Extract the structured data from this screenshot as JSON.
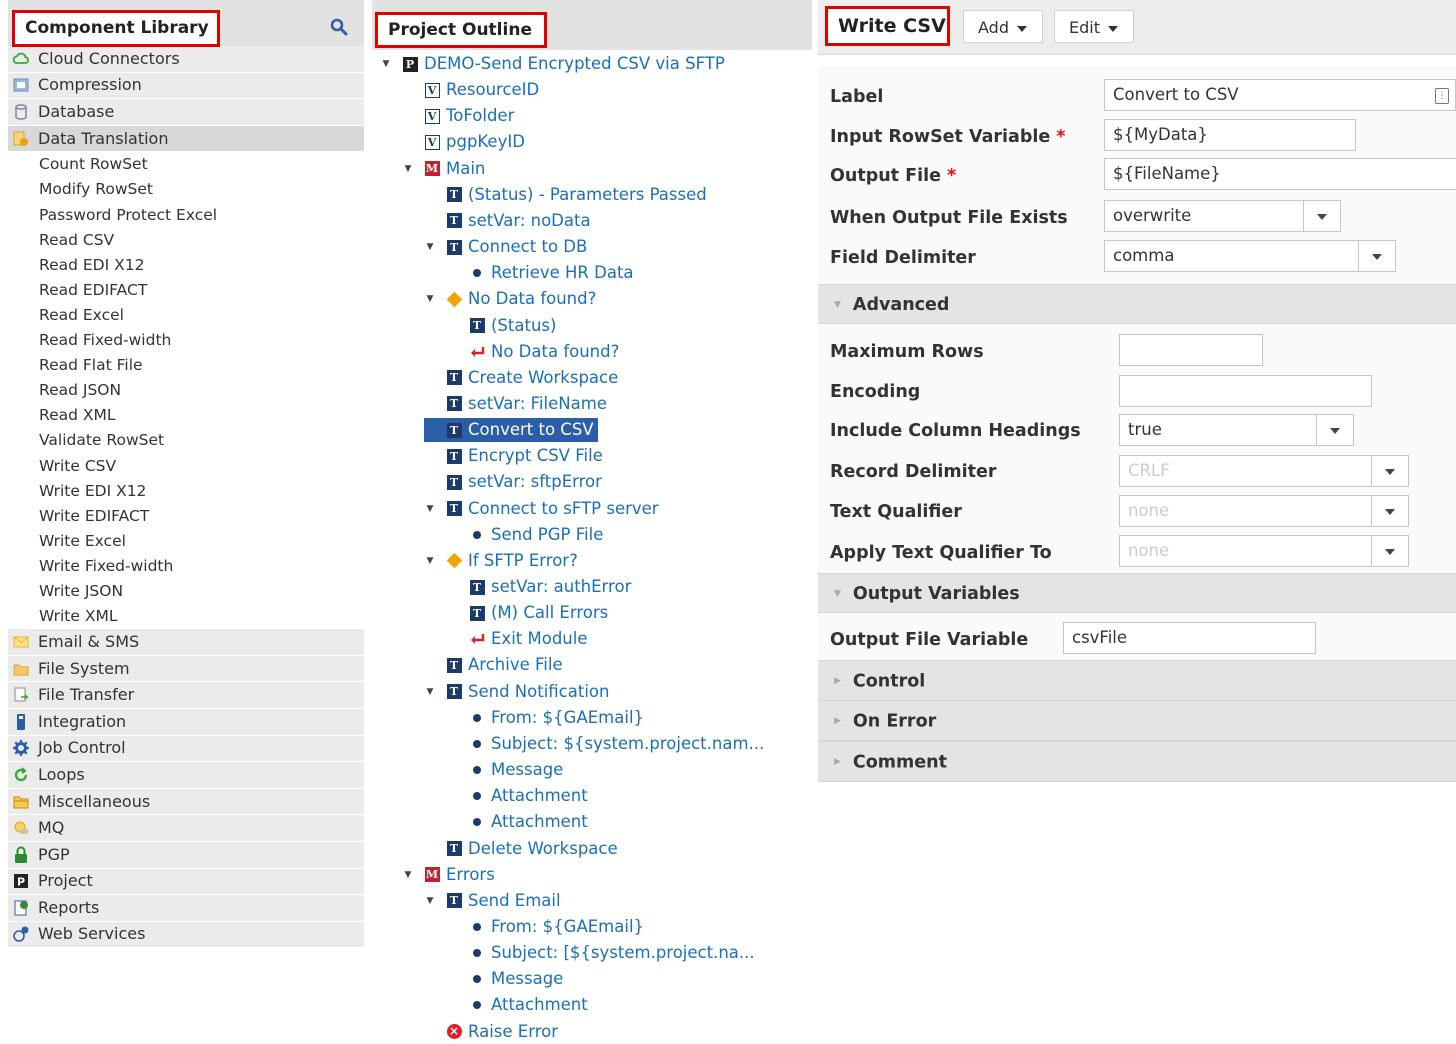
{
  "library": {
    "title": "Component Library",
    "categories_top": [
      {
        "label": "Cloud Connectors",
        "icon": "cloud-icon",
        "color": "#3aaa35"
      },
      {
        "label": "Compression",
        "icon": "compression-icon",
        "color": "#6a8fb3"
      },
      {
        "label": "Database",
        "icon": "database-icon",
        "color": "#7a8a9a"
      },
      {
        "label": "Data Translation",
        "icon": "data-translation-icon",
        "color": "#e8a21a"
      }
    ],
    "data_translation_items": [
      "Count RowSet",
      "Modify RowSet",
      "Password Protect Excel",
      "Read CSV",
      "Read EDI X12",
      "Read EDIFACT",
      "Read Excel",
      "Read Fixed-width",
      "Read Flat File",
      "Read JSON",
      "Read XML",
      "Validate RowSet",
      "Write CSV",
      "Write EDI X12",
      "Write EDIFACT",
      "Write Excel",
      "Write Fixed-width",
      "Write JSON",
      "Write XML"
    ],
    "categories_bottom": [
      {
        "label": "Email & SMS",
        "icon": "email-icon",
        "color": "#f0b323"
      },
      {
        "label": "File System",
        "icon": "folder-icon",
        "color": "#d9a33a"
      },
      {
        "label": "File Transfer",
        "icon": "file-transfer-icon",
        "color": "#4a9a3a"
      },
      {
        "label": "Integration",
        "icon": "integration-icon",
        "color": "#2c5fa6"
      },
      {
        "label": "Job Control",
        "icon": "gear-icon",
        "color": "#2c5fa6"
      },
      {
        "label": "Loops",
        "icon": "loop-icon",
        "color": "#3aaa35"
      },
      {
        "label": "Miscellaneous",
        "icon": "misc-folder-icon",
        "color": "#e0a820"
      },
      {
        "label": "MQ",
        "icon": "mq-icon",
        "color": "#e0a820"
      },
      {
        "label": "PGP",
        "icon": "lock-icon",
        "color": "#2f8a2f"
      },
      {
        "label": "Project",
        "icon": "project-icon",
        "color": "#222222"
      },
      {
        "label": "Reports",
        "icon": "reports-icon",
        "color": "#3a8a3a"
      },
      {
        "label": "Web Services",
        "icon": "web-services-icon",
        "color": "#2c5fa6"
      }
    ]
  },
  "outline": {
    "title": "Project Outline",
    "nodes": [
      {
        "label": "DEMO-Send Encrypted CSV via SFTP",
        "icon": "P",
        "kind": "p",
        "depth": 0,
        "toggle": "down"
      },
      {
        "label": "ResourceID",
        "icon": "V",
        "kind": "v",
        "depth": 1
      },
      {
        "label": "ToFolder",
        "icon": "V",
        "kind": "v",
        "depth": 1
      },
      {
        "label": "pgpKeyID",
        "icon": "V",
        "kind": "v",
        "depth": 1
      },
      {
        "label": "Main",
        "icon": "M",
        "kind": "m",
        "depth": 1,
        "toggle": "down"
      },
      {
        "label": "(Status) - Parameters Passed",
        "icon": "T",
        "kind": "t",
        "depth": 2
      },
      {
        "label": "setVar: noData",
        "icon": "T",
        "kind": "t",
        "depth": 2
      },
      {
        "label": "Connect to DB",
        "icon": "T",
        "kind": "t",
        "depth": 2,
        "toggle": "down"
      },
      {
        "label": "Retrieve HR Data",
        "icon": "",
        "kind": "dot",
        "depth": 3
      },
      {
        "label": "No Data found?",
        "icon": "",
        "kind": "dia",
        "depth": 2,
        "toggle": "down"
      },
      {
        "label": "(Status)",
        "icon": "T",
        "kind": "t",
        "depth": 3
      },
      {
        "label": "No Data found?",
        "icon": "",
        "kind": "ret",
        "depth": 3
      },
      {
        "label": "Create Workspace",
        "icon": "T",
        "kind": "t",
        "depth": 2
      },
      {
        "label": "setVar: FileName",
        "icon": "T",
        "kind": "t",
        "depth": 2
      },
      {
        "label": "Convert to CSV",
        "icon": "T",
        "kind": "t",
        "depth": 2,
        "selected": true
      },
      {
        "label": "Encrypt CSV File",
        "icon": "T",
        "kind": "t",
        "depth": 2
      },
      {
        "label": "setVar: sftpError",
        "icon": "T",
        "kind": "t",
        "depth": 2
      },
      {
        "label": "Connect to sFTP server",
        "icon": "T",
        "kind": "t",
        "depth": 2,
        "toggle": "down"
      },
      {
        "label": "Send PGP File",
        "icon": "",
        "kind": "dot",
        "depth": 3
      },
      {
        "label": "If SFTP Error?",
        "icon": "",
        "kind": "dia",
        "depth": 2,
        "toggle": "down"
      },
      {
        "label": "setVar: authError",
        "icon": "T",
        "kind": "t",
        "depth": 3
      },
      {
        "label": "(M) Call Errors",
        "icon": "T",
        "kind": "t",
        "depth": 3
      },
      {
        "label": "Exit Module",
        "icon": "",
        "kind": "ret",
        "depth": 3
      },
      {
        "label": "Archive File",
        "icon": "T",
        "kind": "t",
        "depth": 2
      },
      {
        "label": "Send Notification",
        "icon": "T",
        "kind": "t",
        "depth": 2,
        "toggle": "down"
      },
      {
        "label": "From: ${GAEmail}",
        "icon": "",
        "kind": "dot",
        "depth": 3
      },
      {
        "label": "Subject: ${system.project.nam...",
        "icon": "",
        "kind": "dot",
        "depth": 3
      },
      {
        "label": "Message",
        "icon": "",
        "kind": "dot",
        "depth": 3
      },
      {
        "label": "Attachment",
        "icon": "",
        "kind": "dot",
        "depth": 3
      },
      {
        "label": "Attachment",
        "icon": "",
        "kind": "dot",
        "depth": 3
      },
      {
        "label": "Delete Workspace",
        "icon": "T",
        "kind": "t",
        "depth": 2
      },
      {
        "label": "Errors",
        "icon": "M",
        "kind": "m",
        "depth": 1,
        "toggle": "down"
      },
      {
        "label": "Send Email",
        "icon": "T",
        "kind": "t",
        "depth": 2,
        "toggle": "down"
      },
      {
        "label": "From: ${GAEmail}",
        "icon": "",
        "kind": "dot",
        "depth": 3
      },
      {
        "label": "Subject: [${system.project.na...",
        "icon": "",
        "kind": "dot",
        "depth": 3
      },
      {
        "label": "Message",
        "icon": "",
        "kind": "dot",
        "depth": 3
      },
      {
        "label": "Attachment",
        "icon": "",
        "kind": "dot",
        "depth": 3
      },
      {
        "label": "Raise Error",
        "icon": "",
        "kind": "x",
        "depth": 2
      }
    ]
  },
  "properties": {
    "title": "Write CSV",
    "add_label": "Add",
    "edit_label": "Edit",
    "label_label": "Label",
    "label_value": "Convert to CSV",
    "input_rowset_label": "Input RowSet Variable",
    "input_rowset_value": "${MyData}",
    "output_file_label": "Output File",
    "output_file_value": "${FileName}",
    "when_exists_label": "When Output File Exists",
    "when_exists_value": "overwrite",
    "field_delim_label": "Field Delimiter",
    "field_delim_value": "comma",
    "required_mark": "*",
    "advanced_label": "Advanced",
    "max_rows_label": "Maximum Rows",
    "max_rows_value": "",
    "encoding_label": "Encoding",
    "encoding_value": "",
    "include_headings_label": "Include Column Headings",
    "include_headings_value": "true",
    "record_delim_label": "Record Delimiter",
    "record_delim_placeholder": "CRLF",
    "text_qualifier_label": "Text Qualifier",
    "text_qualifier_placeholder": "none",
    "apply_qualifier_label": "Apply Text Qualifier To",
    "apply_qualifier_placeholder": "none",
    "output_vars_label": "Output Variables",
    "output_file_var_label": "Output File Variable",
    "output_file_var_value": "csvFile",
    "control_label": "Control",
    "on_error_label": "On Error",
    "comment_label": "Comment"
  }
}
